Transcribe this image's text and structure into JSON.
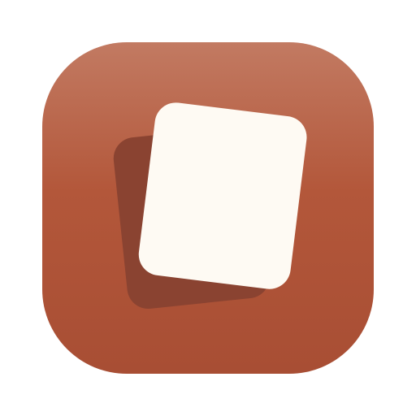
{
  "app_icon": {
    "icon_name": "cards-icon",
    "colors": {
      "tile_top": "#C27A62",
      "tile_mid": "#B3573A",
      "tile_bottom": "#A84E34",
      "back_card": "#8A4331",
      "front_card": "#FEFAF3",
      "background": "#FFFFFF"
    }
  }
}
